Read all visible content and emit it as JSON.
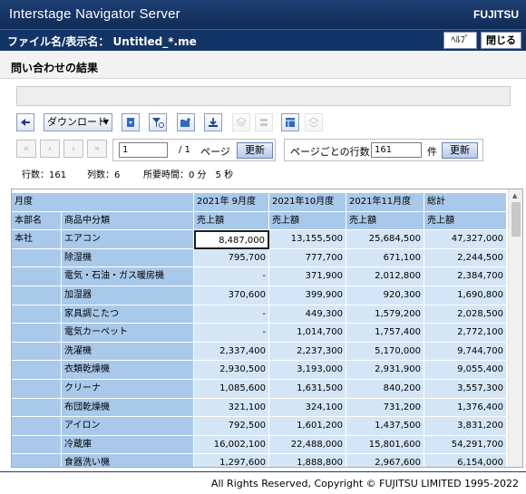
{
  "app": {
    "title": "Interstage Navigator Server",
    "brand": "FUJITSU"
  },
  "header": {
    "file_label": "ファイル名/表示名： Untitled_*.me",
    "help_label": "ﾍﾙﾌﾟ",
    "close_label": "閉じる"
  },
  "page": {
    "title": "問い合わせの結果"
  },
  "toolbar": {
    "download_label": "ダウンロード"
  },
  "nav": {
    "first": "«",
    "prev": "‹",
    "next": "›",
    "last": "»",
    "page_value": "1",
    "page_total": "/ 1",
    "page_label": "ページ",
    "update_label": "更新",
    "rows_per_page_label": "ページごとの行数",
    "rows_per_page_value": "161",
    "rows_unit": "件"
  },
  "stats": {
    "rows": "行数：161",
    "cols": "列数：6",
    "time": "所要時間：0 分　5 秒"
  },
  "table": {
    "corner_month": "月度",
    "col_dept": "本部名",
    "col_category": "商品中分類",
    "months": [
      "2021年 9月度",
      "2021年10月度",
      "2021年11月度",
      "総計"
    ],
    "measure": [
      "売上額",
      "売上額",
      "売上額",
      "売上額"
    ],
    "dept": "本社",
    "rows": [
      {
        "name": "エアコン",
        "v": [
          "8,487,000",
          "13,155,500",
          "25,684,500",
          "47,327,000"
        ]
      },
      {
        "name": "除湿機",
        "v": [
          "795,700",
          "777,700",
          "671,100",
          "2,244,500"
        ]
      },
      {
        "name": "電気・石油・ガス暖房機",
        "v": [
          "-",
          "371,900",
          "2,012,800",
          "2,384,700"
        ]
      },
      {
        "name": "加湿器",
        "v": [
          "370,600",
          "399,900",
          "920,300",
          "1,690,800"
        ]
      },
      {
        "name": "家具調こたつ",
        "v": [
          "-",
          "449,300",
          "1,579,200",
          "2,028,500"
        ]
      },
      {
        "name": "電気カーペット",
        "v": [
          "-",
          "1,014,700",
          "1,757,400",
          "2,772,100"
        ]
      },
      {
        "name": "洗濯機",
        "v": [
          "2,337,400",
          "2,237,300",
          "5,170,000",
          "9,744,700"
        ]
      },
      {
        "name": "衣類乾燥機",
        "v": [
          "2,930,500",
          "3,193,000",
          "2,931,900",
          "9,055,400"
        ]
      },
      {
        "name": "クリーナ",
        "v": [
          "1,085,600",
          "1,631,500",
          "840,200",
          "3,557,300"
        ]
      },
      {
        "name": "布団乾燥機",
        "v": [
          "321,100",
          "324,100",
          "731,200",
          "1,376,400"
        ]
      },
      {
        "name": "アイロン",
        "v": [
          "792,500",
          "1,601,200",
          "1,437,500",
          "3,831,200"
        ]
      },
      {
        "name": "冷蔵庫",
        "v": [
          "16,002,100",
          "22,488,000",
          "15,801,600",
          "54,291,700"
        ]
      },
      {
        "name": "食器洗い機",
        "v": [
          "1,297,600",
          "1,888,800",
          "2,967,600",
          "6,154,000"
        ]
      }
    ]
  },
  "footer": {
    "copyright": "All Rights Reserved, Copyright © FUJITSU LIMITED 1995-2022"
  },
  "colors": {
    "titlebar": "#102c57",
    "header_cell": "#a9c9ea",
    "value_cell": "#d4e6f6"
  }
}
